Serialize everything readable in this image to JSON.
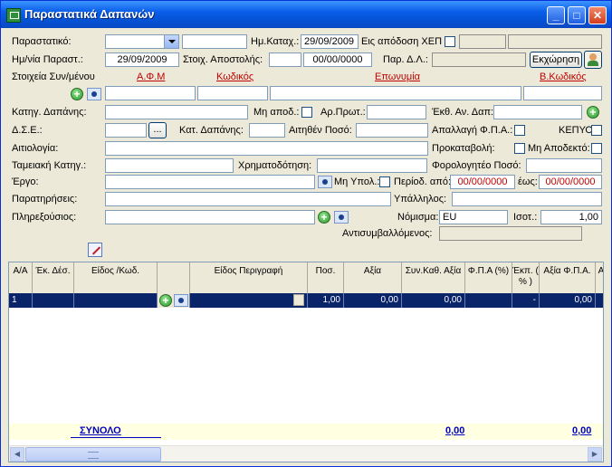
{
  "window": {
    "title": "Παραστατικά Δαπανών",
    "min": "_",
    "max": "□",
    "close": "✕"
  },
  "form": {
    "parastatiko_label": "Παραστατικό:",
    "hm_kataxorisis_label": "Ημ.Καταχ.:",
    "hm_kataxorisis": "29/09/2009",
    "eis_apodosi_label": "Εις απόδοση ΧΕΠ",
    "hm_parast_label": "Ημ/νία Παραστ.:",
    "hm_parast": "29/09/2009",
    "stoix_apostolis_label": "Στοιχ. Αποστολής:",
    "stoix_apostolis_date": "00/00/0000",
    "par_dl_label": "Παρ. Δ.Λ.:",
    "ekxorisi_button": "Εκχώρηση",
    "stoixeia_label": "Στοιχεία Συν/μένου",
    "afm_header": "Α.Φ.Μ",
    "kodikos_header": "Κωδικός",
    "eponymia_header": "Επωνυμία",
    "vkodikos_header": "Β.Κωδικός",
    "katigoria_label": "Κατηγ. Δαπάνης:",
    "mi_apod_label": "Μη αποδ.:",
    "ar_prot_label": "Αρ.Πρωτ.:",
    "ekth_label": "Έκθ. Αν. Δαπ:",
    "dse_label": "Δ.Σ.Ε.:",
    "dots_button": "...",
    "kat_dapanis_label": "Κατ. Δαπάνης:",
    "aitithen_label": "Αιτηθέν Ποσό:",
    "apallagi_label": "Απαλλαγή Φ.Π.Α.:",
    "kepyo_label": "ΚΕΠΥΟ:",
    "aitiologia_label": "Αιτιολογία:",
    "prokatavoli_label": "Προκαταβολή:",
    "mi_apodekto_label": "Μη Αποδεκτό:",
    "tameiaki_label": "Ταμειακή Κατηγ.:",
    "xrimatodotisi_label": "Χρηματοδότηση:",
    "forologiteo_label": "Φορολογητέο Ποσό:",
    "ergo_label": "Έργο:",
    "mi_ypol_label": "Μη Υπολ.:",
    "periodos_apo_label": "Περίοδ. από:",
    "periodos_apo": "00/00/0000",
    "eos_label": "έως:",
    "eos": "00/00/0000",
    "paratiriseis_label": "Παρατηρήσεις:",
    "ypallilos_label": "Υπάλληλος:",
    "plirexousios_label": "Πληρεξούσιος:",
    "nomisma_label": "Νόμισμα:",
    "nomisma": "EU",
    "isot_label": "Ισοτ.:",
    "isot": "1,00",
    "antisymv_label": "Αντισυμβαλλόμενος:"
  },
  "grid": {
    "headers": {
      "aa": "Α/Α",
      "ekdes": "Έκ. Δέσ.",
      "eidos_kod": "Είδος /Κωδ.",
      "eidos_perigrafi": "Είδος Περιγραφή",
      "pos": "Ποσ.",
      "axia": "Αξία",
      "syn_kath_axia": "Συν.Καθ. Αξία",
      "fpa_pct": "Φ.Π.Α (%)",
      "ekp": "Έκπ. ( % )",
      "axia_fpa": "Αξία Φ.Π.Α.",
      "more": "Α"
    },
    "row": {
      "aa": "1",
      "pos": "1,00",
      "axia": "0,00",
      "syn_kath_axia": "0,00",
      "ekp": "-",
      "axia_fpa": "0,00"
    },
    "totals": {
      "label": "ΣΥΝΟΛΟ",
      "total1": "0,00",
      "total2": "0,00"
    }
  }
}
